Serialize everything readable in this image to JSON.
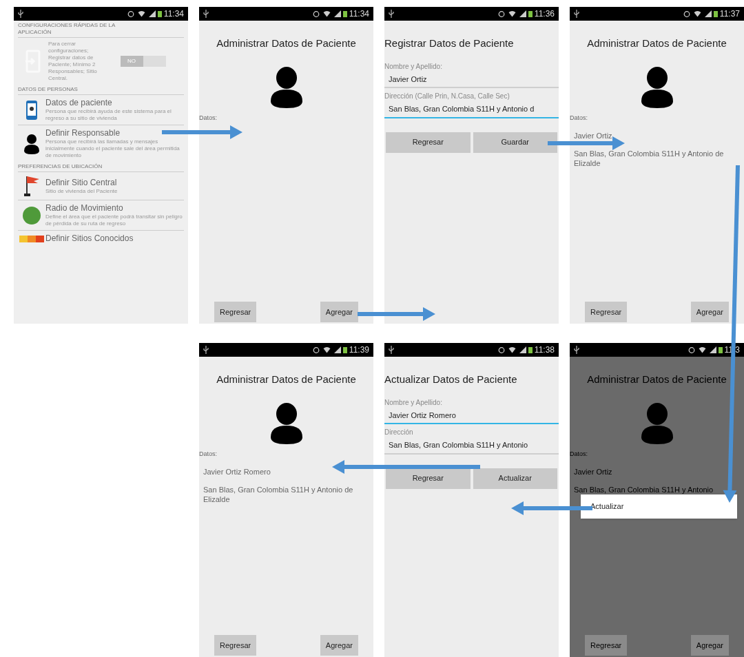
{
  "rows": [
    {
      "screens": [
        {
          "kind": "settings",
          "status_time": "11:34",
          "sections": [
            {
              "header": "CONFIGURACIONES RÁPIDAS DE LA APLICACIÓN",
              "items": [
                {
                  "kind": "toggle",
                  "description": "Para cerrar configuraciones; Registrar datos de Paciente; Mínimo 2 Responsables; Sitio Central.",
                  "toggle_label": "NO",
                  "on": false
                }
              ]
            },
            {
              "header": "DATOS DE PERSONAS",
              "items": [
                {
                  "kind": "entry",
                  "title": "Datos de paciente",
                  "description": "Persona que recibirá ayuda de este sistema para el regreso a su sitio de vivienda"
                },
                {
                  "kind": "entry",
                  "title": "Definir Responsable",
                  "description": "Persona que recibirá las llamadas y mensajes inicialmente cuando el paciente sale del área permitida de movimiento"
                }
              ]
            },
            {
              "header": "PREFERENCIAS DE UBICACIÓN",
              "items": [
                {
                  "kind": "entry",
                  "title": "Definir Sitio Central",
                  "description": "Sitio de vivienda del Paciente"
                },
                {
                  "kind": "entry",
                  "title": "Radio de Movimiento",
                  "description": "Define el área que el paciente podrá transitar sin peligro de pérdida de su ruta de regreso"
                },
                {
                  "kind": "entry",
                  "title": "Definir Sitios Conocidos"
                }
              ]
            }
          ]
        },
        {
          "kind": "manage",
          "status_time": "11:34",
          "title": "Administrar Datos de Paciente",
          "data_label": "Datos:",
          "buttons": [
            "Regresar",
            "Agregar"
          ]
        },
        {
          "kind": "form",
          "status_time": "11:36",
          "title": "Registrar Datos de Paciente",
          "fields": [
            {
              "label": "Nombre y Apellido:",
              "value": "Javier Ortiz",
              "focused": false
            },
            {
              "label": "Dirección (Calle Prin, N.Casa, Calle Sec)",
              "value": "San Blas, Gran Colombia S11H y Antonio d",
              "focused": true
            }
          ],
          "buttons": [
            "Regresar",
            "Guardar"
          ]
        },
        {
          "kind": "manage",
          "status_time": "11:37",
          "title": "Administrar Datos de Paciente",
          "data_label": "Datos:",
          "entries": [
            "Javier Ortiz",
            "San Blas, Gran Colombia S11H y Antonio de Elizalde"
          ],
          "buttons": [
            "Regresar",
            "Agregar"
          ]
        }
      ]
    },
    {
      "screens": [
        {
          "kind": "manage",
          "status_time": "11:39",
          "title": "Administrar Datos de Paciente",
          "data_label": "Datos:",
          "entries": [
            "Javier Ortiz Romero",
            "San Blas, Gran Colombia S11H y Antonio de Elizalde"
          ],
          "buttons": [
            "Regresar",
            "Agregar"
          ]
        },
        {
          "kind": "form",
          "status_time": "11:38",
          "title": "Actualizar Datos de Paciente",
          "fields": [
            {
              "label": "Nombre y Apellido:",
              "value": "Javier Ortiz Romero",
              "focused": true
            },
            {
              "label": "Dirección",
              "value": "San Blas, Gran Colombia S11H y Antonio",
              "focused": false
            }
          ],
          "buttons": [
            "Regresar",
            "Actualizar"
          ]
        },
        {
          "kind": "manage",
          "status_time": "11:3",
          "title": "Administrar Datos de Paciente",
          "data_label": "Datos:",
          "entries": [
            "Javier Ortiz",
            "San Blas, Gran Colombia S11H y Antonio"
          ],
          "buttons": [
            "Regresar",
            "Agregar"
          ],
          "dialog": {
            "items": [
              "Actualizar"
            ]
          }
        }
      ]
    }
  ]
}
